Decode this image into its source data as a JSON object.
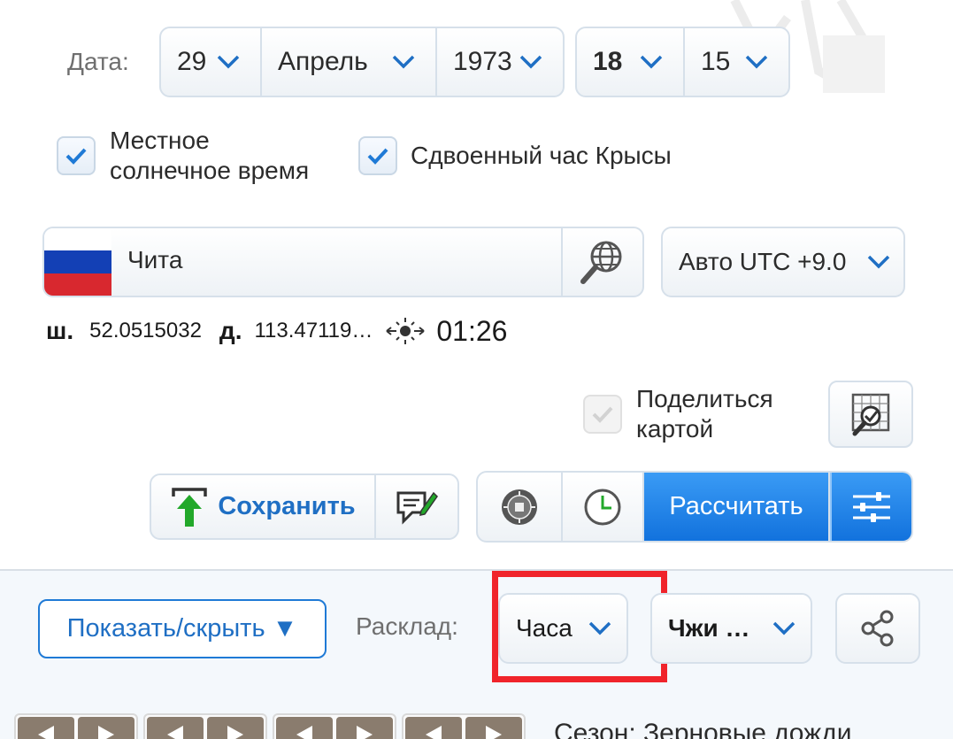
{
  "date_label": "Дата:",
  "date": {
    "day": "29",
    "month": "Апрель",
    "year": "1973"
  },
  "time": {
    "hour": "18",
    "minute": "15"
  },
  "checkboxes": {
    "local_solar_time": {
      "label_line1": "Местное",
      "label_line2": "солнечное время",
      "checked": true
    },
    "double_rat_hour": {
      "label": "Сдвоенный час Крысы",
      "checked": true
    },
    "share_map": {
      "label_line1": "Поделиться",
      "label_line2": "картой",
      "checked": true,
      "disabled": true
    }
  },
  "location": {
    "city": "Чита",
    "flag": "russia-flag",
    "timezone": "Авто UTC +9.0"
  },
  "coordinates": {
    "lat_label": "ш.",
    "lat": "52.0515032",
    "lon_label": "д.",
    "lon": "113.47119…",
    "solar_time": "01:26"
  },
  "actions": {
    "save_label": "Сохранить",
    "calculate_label": "Рассчитать"
  },
  "toolbar": {
    "show_hide_label": "Показать/скрыть ▼",
    "layout_label": "Расклад:",
    "layout_value": "Часа",
    "method_value": "Чжи …"
  },
  "season_text": "Сезон: Зерновые дожди",
  "colors": {
    "accent": "#1f6fc4",
    "primary_button": "#1272dd",
    "highlight": "#f0242b",
    "save_arrow": "#22a82a"
  }
}
